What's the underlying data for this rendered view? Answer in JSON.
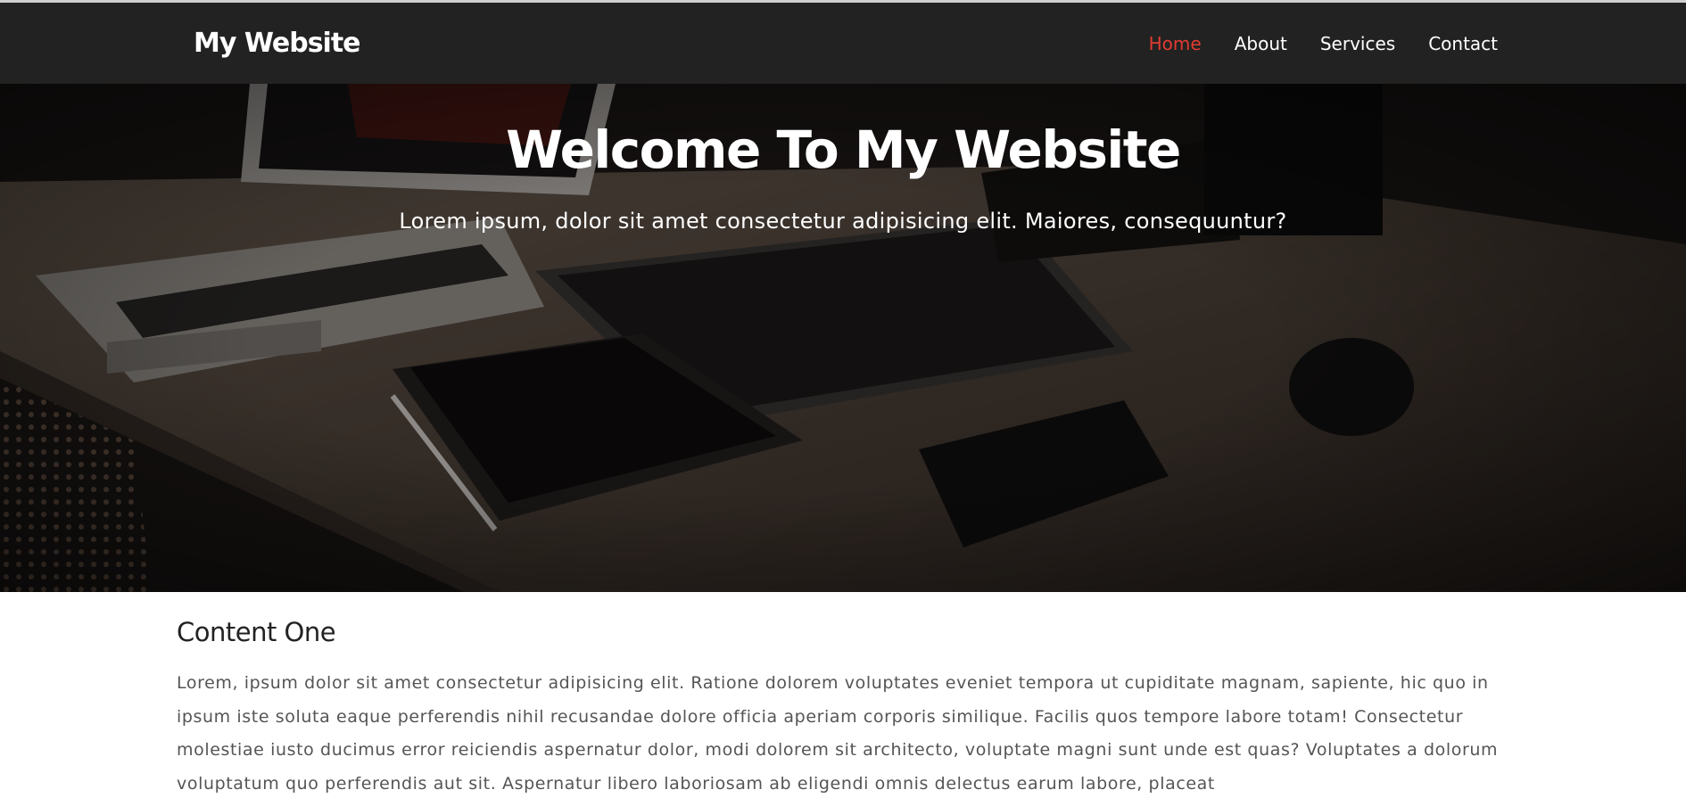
{
  "navbar": {
    "brand": "My Website",
    "links": [
      {
        "label": "Home",
        "active": true
      },
      {
        "label": "About",
        "active": false
      },
      {
        "label": "Services",
        "active": false
      },
      {
        "label": "Contact",
        "active": false
      }
    ],
    "background": "#222222",
    "active_color": "#e03c31"
  },
  "hero": {
    "title": "Welcome To My Website",
    "subtitle": "Lorem ipsum, dolor sit amet consectetur adipisicing elit. Maiores, consequuntur?"
  },
  "content": {
    "title": "Content One",
    "text": "Lorem, ipsum dolor sit amet consectetur adipisicing elit. Ratione dolorem voluptates eveniet tempora ut cupiditate magnam, sapiente, hic quo in ipsum iste soluta eaque perferendis nihil recusandae dolore officia aperiam corporis similique. Facilis quos tempore labore totam! Consectetur molestiae iusto ducimus error reiciendis aspernatur dolor, modi dolorem sit architecto, voluptate magni sunt unde est quas? Voluptates a dolorum voluptatum quo perferendis aut sit. Aspernatur libero laboriosam ab eligendi omnis delectus earum labore, placeat"
  }
}
